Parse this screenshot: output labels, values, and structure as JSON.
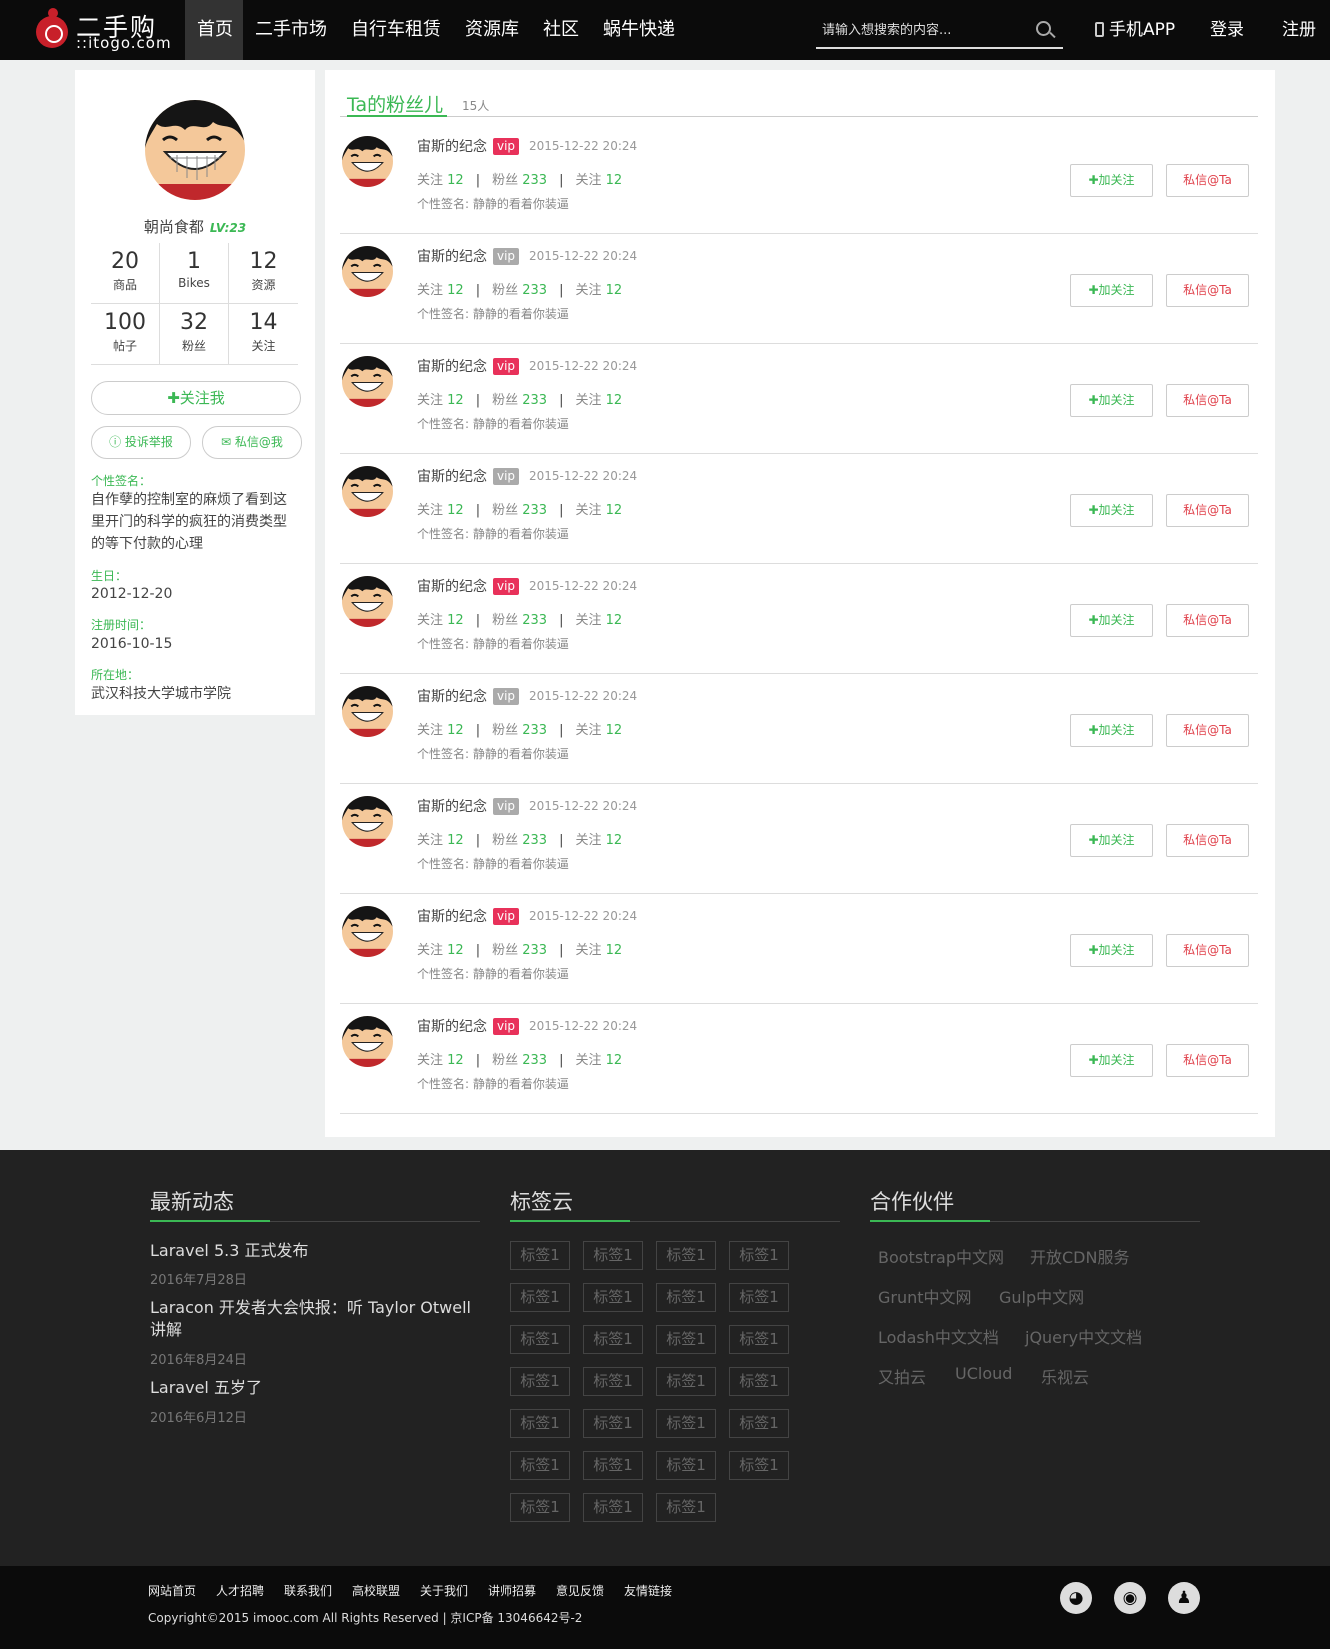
{
  "header": {
    "logo_cn": "二手购",
    "logo_en": "::itogo.com",
    "nav": [
      "首页",
      "二手市场",
      "自行车租赁",
      "资源库",
      "社区",
      "蜗牛快递"
    ],
    "search_placeholder": "请输入想搜索的内容...",
    "app": "手机APP",
    "login": "登录",
    "register": "注册"
  },
  "profile": {
    "name": "朝尚食都",
    "level": "LV:23",
    "stats": [
      {
        "num": "20",
        "label": "商品"
      },
      {
        "num": "1",
        "label": "Bikes"
      },
      {
        "num": "12",
        "label": "资源"
      },
      {
        "num": "100",
        "label": "帖子"
      },
      {
        "num": "32",
        "label": "粉丝"
      },
      {
        "num": "14",
        "label": "关注"
      }
    ],
    "follow_btn": "✚关注我",
    "report_btn": "投诉举报",
    "msg_btn": "私信@我",
    "sig_label": "个性签名：",
    "sig_value": "自作孽的控制室的麻烦了看到这里开门的科学的疯狂的消费类型的等下付款的心理",
    "birthday_label": "生日：",
    "birthday_value": "2012-12-20",
    "reg_label": "注册时间：",
    "reg_value": "2016-10-15",
    "loc_label": "所在地：",
    "loc_value": "武汉科技大学城市学院"
  },
  "fans": {
    "title": "Ta的粉丝儿",
    "count": "15人",
    "colors": {
      "vip_active": "#e8315a",
      "vip_inactive": "#aaaaaa",
      "accent": "#3bb854"
    },
    "items": [
      {
        "name": "宙斯的纪念",
        "vip": "vip",
        "vip_active": true,
        "date": "2015-12-22 20:24",
        "follow_label": "关注",
        "follow": "12",
        "fans_label": "粉丝",
        "fans": "233",
        "follow2_label": "关注",
        "follow2": "12",
        "sig": "个性签名: 静静的看着你装逼",
        "btn_follow": "加关注",
        "btn_msg": "私信@Ta"
      },
      {
        "name": "宙斯的纪念",
        "vip": "vip",
        "vip_active": false,
        "date": "2015-12-22 20:24",
        "follow_label": "关注",
        "follow": "12",
        "fans_label": "粉丝",
        "fans": "233",
        "follow2_label": "关注",
        "follow2": "12",
        "sig": "个性签名: 静静的看着你装逼",
        "btn_follow": "加关注",
        "btn_msg": "私信@Ta"
      },
      {
        "name": "宙斯的纪念",
        "vip": "vip",
        "vip_active": true,
        "date": "2015-12-22 20:24",
        "follow_label": "关注",
        "follow": "12",
        "fans_label": "粉丝",
        "fans": "233",
        "follow2_label": "关注",
        "follow2": "12",
        "sig": "个性签名: 静静的看着你装逼",
        "btn_follow": "加关注",
        "btn_msg": "私信@Ta"
      },
      {
        "name": "宙斯的纪念",
        "vip": "vip",
        "vip_active": false,
        "date": "2015-12-22 20:24",
        "follow_label": "关注",
        "follow": "12",
        "fans_label": "粉丝",
        "fans": "233",
        "follow2_label": "关注",
        "follow2": "12",
        "sig": "个性签名: 静静的看着你装逼",
        "btn_follow": "加关注",
        "btn_msg": "私信@Ta"
      },
      {
        "name": "宙斯的纪念",
        "vip": "vip",
        "vip_active": true,
        "date": "2015-12-22 20:24",
        "follow_label": "关注",
        "follow": "12",
        "fans_label": "粉丝",
        "fans": "233",
        "follow2_label": "关注",
        "follow2": "12",
        "sig": "个性签名: 静静的看着你装逼",
        "btn_follow": "加关注",
        "btn_msg": "私信@Ta"
      },
      {
        "name": "宙斯的纪念",
        "vip": "vip",
        "vip_active": false,
        "date": "2015-12-22 20:24",
        "follow_label": "关注",
        "follow": "12",
        "fans_label": "粉丝",
        "fans": "233",
        "follow2_label": "关注",
        "follow2": "12",
        "sig": "个性签名: 静静的看着你装逼",
        "btn_follow": "加关注",
        "btn_msg": "私信@Ta"
      },
      {
        "name": "宙斯的纪念",
        "vip": "vip",
        "vip_active": false,
        "date": "2015-12-22 20:24",
        "follow_label": "关注",
        "follow": "12",
        "fans_label": "粉丝",
        "fans": "233",
        "follow2_label": "关注",
        "follow2": "12",
        "sig": "个性签名: 静静的看着你装逼",
        "btn_follow": "加关注",
        "btn_msg": "私信@Ta"
      },
      {
        "name": "宙斯的纪念",
        "vip": "vip",
        "vip_active": true,
        "date": "2015-12-22 20:24",
        "follow_label": "关注",
        "follow": "12",
        "fans_label": "粉丝",
        "fans": "233",
        "follow2_label": "关注",
        "follow2": "12",
        "sig": "个性签名: 静静的看着你装逼",
        "btn_follow": "加关注",
        "btn_msg": "私信@Ta"
      },
      {
        "name": "宙斯的纪念",
        "vip": "vip",
        "vip_active": true,
        "date": "2015-12-22 20:24",
        "follow_label": "关注",
        "follow": "12",
        "fans_label": "粉丝",
        "fans": "233",
        "follow2_label": "关注",
        "follow2": "12",
        "sig": "个性签名: 静静的看着你装逼",
        "btn_follow": "加关注",
        "btn_msg": "私信@Ta"
      }
    ]
  },
  "footer": {
    "news_title": "最新动态",
    "news": [
      {
        "title": "Laravel 5.3 正式发布",
        "date": "2016年7月28日"
      },
      {
        "title": "Laracon 开发者大会快报：听 Taylor Otwell 讲解",
        "date": "2016年8月24日"
      },
      {
        "title": "Laravel 五岁了",
        "date": "2016年6月12日"
      }
    ],
    "tags_title": "标签云",
    "tags": [
      "标签1",
      "标签1",
      "标签1",
      "标签1",
      "标签1",
      "标签1",
      "标签1",
      "标签1",
      "标签1",
      "标签1",
      "标签1",
      "标签1",
      "标签1",
      "标签1",
      "标签1",
      "标签1",
      "标签1",
      "标签1",
      "标签1",
      "标签1",
      "标签1",
      "标签1",
      "标签1",
      "标签1",
      "标签1",
      "标签1",
      "标签1"
    ],
    "partners_title": "合作伙伴",
    "partners": [
      [
        "Bootstrap中文网",
        "开放CDN服务"
      ],
      [
        "Grunt中文网",
        "Gulp中文网"
      ],
      [
        "Lodash中文文档",
        "jQuery中文文档"
      ],
      [
        "又拍云",
        "UCloud",
        "乐视云"
      ]
    ],
    "links": [
      "网站首页",
      "人才招聘",
      "联系我们",
      "高校联盟",
      "关于我们",
      "讲师招募",
      "意见反馈",
      "友情链接"
    ],
    "copyright": "Copyright©2015 imooc.com All Rights Reserved | 京ICP备 13046642号-2",
    "social": [
      "wechat-icon",
      "weibo-icon",
      "qq-icon"
    ]
  }
}
